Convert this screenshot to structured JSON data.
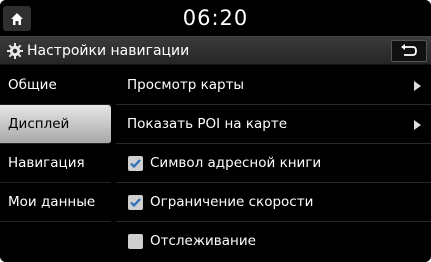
{
  "status_bar": {
    "clock": "06:20"
  },
  "title_bar": {
    "title": "Настройки навигации",
    "icon": "gear-icon",
    "back_icon": "back-arrow-icon"
  },
  "tabs": [
    {
      "label": "Общие",
      "active": false
    },
    {
      "label": "Дисплей",
      "active": true
    },
    {
      "label": "Навигация",
      "active": false
    },
    {
      "label": "Мои данные",
      "active": false
    }
  ],
  "list": [
    {
      "label": "Просмотр карты",
      "type": "submenu"
    },
    {
      "label": "Показать POI на карте",
      "type": "submenu"
    },
    {
      "label": "Символ адресной книги",
      "type": "checkbox",
      "checked": true
    },
    {
      "label": "Ограничение скорости",
      "type": "checkbox",
      "checked": true
    },
    {
      "label": "Отслеживание",
      "type": "checkbox",
      "checked": false
    }
  ],
  "colors": {
    "background": "#000000",
    "active_tab": "#d0d0d0",
    "checkbox": "#cfcfcf"
  }
}
